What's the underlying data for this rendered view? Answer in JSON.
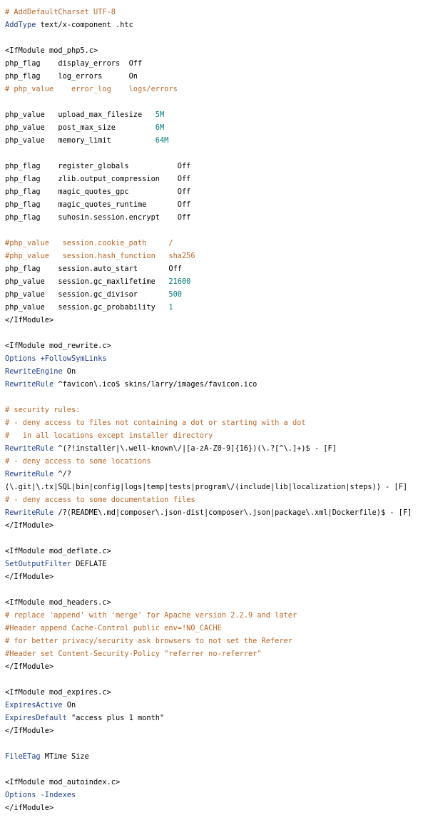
{
  "colors": {
    "comment": "#b8682a",
    "directive": "#1f3f86",
    "value": "#007a7a",
    "text": "#000000",
    "background": "#ffffff"
  },
  "lines": [
    [
      {
        "t": "# AddDefaultCharset UTF-8",
        "k": "c"
      }
    ],
    [
      {
        "t": "AddType",
        "k": "d"
      },
      {
        "t": " text/x-component .htc",
        "k": "t"
      }
    ],
    [],
    [
      {
        "t": "<IfModule mod_php5.c>",
        "k": "t"
      }
    ],
    [
      {
        "t": "php_flag    display_errors  ",
        "k": "t"
      },
      {
        "t": "Off",
        "k": "t"
      }
    ],
    [
      {
        "t": "php_flag    log_errors      ",
        "k": "t"
      },
      {
        "t": "On",
        "k": "t"
      }
    ],
    [
      {
        "t": "# php_value    error_log    logs/errors",
        "k": "c"
      }
    ],
    [],
    [
      {
        "t": "php_value   upload_max_filesize   ",
        "k": "t"
      },
      {
        "t": "5M",
        "k": "v"
      }
    ],
    [
      {
        "t": "php_value   post_max_size         ",
        "k": "t"
      },
      {
        "t": "6M",
        "k": "v"
      }
    ],
    [
      {
        "t": "php_value   memory_limit          ",
        "k": "t"
      },
      {
        "t": "64M",
        "k": "v"
      }
    ],
    [],
    [
      {
        "t": "php_flag    register_globals           ",
        "k": "t"
      },
      {
        "t": "Off",
        "k": "t"
      }
    ],
    [
      {
        "t": "php_flag    zlib.output_compression    ",
        "k": "t"
      },
      {
        "t": "Off",
        "k": "t"
      }
    ],
    [
      {
        "t": "php_flag    magic_quotes_gpc           ",
        "k": "t"
      },
      {
        "t": "Off",
        "k": "t"
      }
    ],
    [
      {
        "t": "php_flag    magic_quotes_runtime       ",
        "k": "t"
      },
      {
        "t": "Off",
        "k": "t"
      }
    ],
    [
      {
        "t": "php_flag    suhosin.session.encrypt    ",
        "k": "t"
      },
      {
        "t": "Off",
        "k": "t"
      }
    ],
    [],
    [
      {
        "t": "#php_value   session.cookie_path     /",
        "k": "c"
      }
    ],
    [
      {
        "t": "#php_value   session.hash_function   sha256",
        "k": "c"
      }
    ],
    [
      {
        "t": "php_flag    session.auto_start       ",
        "k": "t"
      },
      {
        "t": "Off",
        "k": "t"
      }
    ],
    [
      {
        "t": "php_value   session.gc_maxlifetime   ",
        "k": "t"
      },
      {
        "t": "21600",
        "k": "v"
      }
    ],
    [
      {
        "t": "php_value   session.gc_divisor       ",
        "k": "t"
      },
      {
        "t": "500",
        "k": "v"
      }
    ],
    [
      {
        "t": "php_value   session.gc_probability   ",
        "k": "t"
      },
      {
        "t": "1",
        "k": "v"
      }
    ],
    [
      {
        "t": "</IfModule>",
        "k": "t"
      }
    ],
    [],
    [
      {
        "t": "<IfModule mod_rewrite.c>",
        "k": "t"
      }
    ],
    [
      {
        "t": "Options",
        "k": "d"
      },
      {
        "t": " +FollowSymLinks",
        "k": "d"
      }
    ],
    [
      {
        "t": "RewriteEngine",
        "k": "d"
      },
      {
        "t": " On",
        "k": "t"
      }
    ],
    [
      {
        "t": "RewriteRule",
        "k": "d"
      },
      {
        "t": " ^favicon\\.ico$ skins/larry/images/favicon.ico",
        "k": "t"
      }
    ],
    [],
    [
      {
        "t": "# security rules:",
        "k": "c"
      }
    ],
    [
      {
        "t": "# - deny access to files not containing a dot or starting with a dot",
        "k": "c"
      }
    ],
    [
      {
        "t": "#   in all locations except installer directory",
        "k": "c"
      }
    ],
    [
      {
        "t": "RewriteRule",
        "k": "d"
      },
      {
        "t": " ^(?!installer|\\.well-known\\/|[a-zA-Z0-9]{16})(\\.?[^\\.]+)$ - [F]",
        "k": "t"
      }
    ],
    [
      {
        "t": "# - deny access to some locations",
        "k": "c"
      }
    ],
    [
      {
        "t": "RewriteRule",
        "k": "d"
      },
      {
        "t": " ^/?",
        "k": "t"
      }
    ],
    [
      {
        "t": "(\\.git|\\.tx|SQL|bin|config|logs|temp|tests|program\\/(include|lib|localization|steps)) - [F]",
        "k": "t"
      }
    ],
    [
      {
        "t": "# - deny access to some documentation files",
        "k": "c"
      }
    ],
    [
      {
        "t": "RewriteRule",
        "k": "d"
      },
      {
        "t": " /?(README\\.md|composer\\.json-dist|composer\\.json|package\\.xml|Dockerfile)$ - [F]",
        "k": "t"
      }
    ],
    [
      {
        "t": "</IfModule>",
        "k": "t"
      }
    ],
    [],
    [
      {
        "t": "<IfModule mod_deflate.c>",
        "k": "t"
      }
    ],
    [
      {
        "t": "SetOutputFilter",
        "k": "d"
      },
      {
        "t": " DEFLATE",
        "k": "t"
      }
    ],
    [
      {
        "t": "</IfModule>",
        "k": "t"
      }
    ],
    [],
    [
      {
        "t": "<IfModule mod_headers.c>",
        "k": "t"
      }
    ],
    [
      {
        "t": "# replace 'append' with 'merge' for Apache version 2.2.9 and later",
        "k": "c"
      }
    ],
    [
      {
        "t": "#Header append Cache-Control public env=!NO_CACHE",
        "k": "c"
      }
    ],
    [
      {
        "t": "# for better privacy/security ask browsers to not set the Referer",
        "k": "c"
      }
    ],
    [
      {
        "t": "#Header set Content-Security-Policy \"referrer no-referrer\"",
        "k": "c"
      }
    ],
    [
      {
        "t": "</IfModule>",
        "k": "t"
      }
    ],
    [],
    [
      {
        "t": "<IfModule mod_expires.c>",
        "k": "t"
      }
    ],
    [
      {
        "t": "ExpiresActive",
        "k": "d"
      },
      {
        "t": " On",
        "k": "t"
      }
    ],
    [
      {
        "t": "ExpiresDefault",
        "k": "d"
      },
      {
        "t": " \"access plus 1 month\"",
        "k": "t"
      }
    ],
    [
      {
        "t": "</IfModule>",
        "k": "t"
      }
    ],
    [],
    [
      {
        "t": "FileETag",
        "k": "d"
      },
      {
        "t": " MTime Size",
        "k": "t"
      }
    ],
    [],
    [
      {
        "t": "<IfModule mod_autoindex.c>",
        "k": "t"
      }
    ],
    [
      {
        "t": "Options",
        "k": "d"
      },
      {
        "t": " -Indexes",
        "k": "d"
      }
    ],
    [
      {
        "t": "</ifModule>",
        "k": "t"
      }
    ]
  ]
}
